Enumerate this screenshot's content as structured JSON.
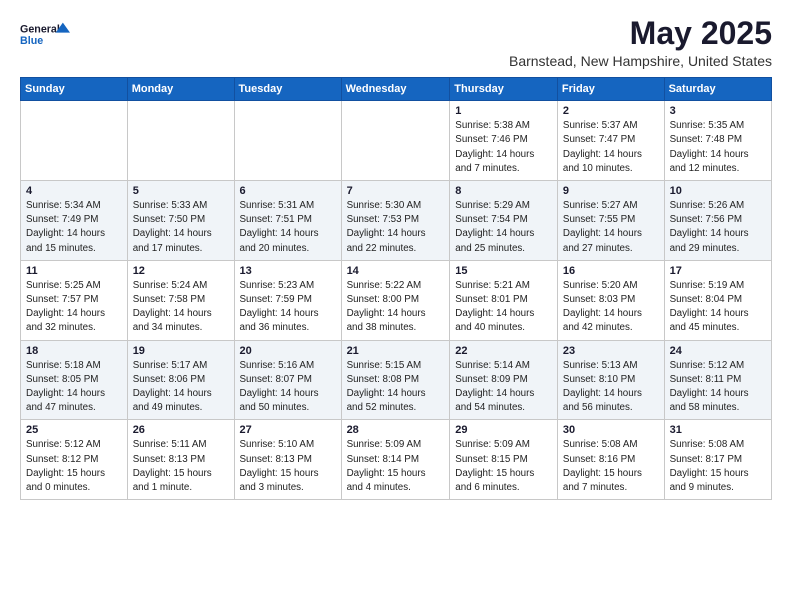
{
  "logo": {
    "text1": "General",
    "text2": "Blue"
  },
  "title": "May 2025",
  "subtitle": "Barnstead, New Hampshire, United States",
  "days_of_week": [
    "Sunday",
    "Monday",
    "Tuesday",
    "Wednesday",
    "Thursday",
    "Friday",
    "Saturday"
  ],
  "weeks": [
    [
      {
        "day": "",
        "detail": ""
      },
      {
        "day": "",
        "detail": ""
      },
      {
        "day": "",
        "detail": ""
      },
      {
        "day": "",
        "detail": ""
      },
      {
        "day": "1",
        "detail": "Sunrise: 5:38 AM\nSunset: 7:46 PM\nDaylight: 14 hours\nand 7 minutes."
      },
      {
        "day": "2",
        "detail": "Sunrise: 5:37 AM\nSunset: 7:47 PM\nDaylight: 14 hours\nand 10 minutes."
      },
      {
        "day": "3",
        "detail": "Sunrise: 5:35 AM\nSunset: 7:48 PM\nDaylight: 14 hours\nand 12 minutes."
      }
    ],
    [
      {
        "day": "4",
        "detail": "Sunrise: 5:34 AM\nSunset: 7:49 PM\nDaylight: 14 hours\nand 15 minutes."
      },
      {
        "day": "5",
        "detail": "Sunrise: 5:33 AM\nSunset: 7:50 PM\nDaylight: 14 hours\nand 17 minutes."
      },
      {
        "day": "6",
        "detail": "Sunrise: 5:31 AM\nSunset: 7:51 PM\nDaylight: 14 hours\nand 20 minutes."
      },
      {
        "day": "7",
        "detail": "Sunrise: 5:30 AM\nSunset: 7:53 PM\nDaylight: 14 hours\nand 22 minutes."
      },
      {
        "day": "8",
        "detail": "Sunrise: 5:29 AM\nSunset: 7:54 PM\nDaylight: 14 hours\nand 25 minutes."
      },
      {
        "day": "9",
        "detail": "Sunrise: 5:27 AM\nSunset: 7:55 PM\nDaylight: 14 hours\nand 27 minutes."
      },
      {
        "day": "10",
        "detail": "Sunrise: 5:26 AM\nSunset: 7:56 PM\nDaylight: 14 hours\nand 29 minutes."
      }
    ],
    [
      {
        "day": "11",
        "detail": "Sunrise: 5:25 AM\nSunset: 7:57 PM\nDaylight: 14 hours\nand 32 minutes."
      },
      {
        "day": "12",
        "detail": "Sunrise: 5:24 AM\nSunset: 7:58 PM\nDaylight: 14 hours\nand 34 minutes."
      },
      {
        "day": "13",
        "detail": "Sunrise: 5:23 AM\nSunset: 7:59 PM\nDaylight: 14 hours\nand 36 minutes."
      },
      {
        "day": "14",
        "detail": "Sunrise: 5:22 AM\nSunset: 8:00 PM\nDaylight: 14 hours\nand 38 minutes."
      },
      {
        "day": "15",
        "detail": "Sunrise: 5:21 AM\nSunset: 8:01 PM\nDaylight: 14 hours\nand 40 minutes."
      },
      {
        "day": "16",
        "detail": "Sunrise: 5:20 AM\nSunset: 8:03 PM\nDaylight: 14 hours\nand 42 minutes."
      },
      {
        "day": "17",
        "detail": "Sunrise: 5:19 AM\nSunset: 8:04 PM\nDaylight: 14 hours\nand 45 minutes."
      }
    ],
    [
      {
        "day": "18",
        "detail": "Sunrise: 5:18 AM\nSunset: 8:05 PM\nDaylight: 14 hours\nand 47 minutes."
      },
      {
        "day": "19",
        "detail": "Sunrise: 5:17 AM\nSunset: 8:06 PM\nDaylight: 14 hours\nand 49 minutes."
      },
      {
        "day": "20",
        "detail": "Sunrise: 5:16 AM\nSunset: 8:07 PM\nDaylight: 14 hours\nand 50 minutes."
      },
      {
        "day": "21",
        "detail": "Sunrise: 5:15 AM\nSunset: 8:08 PM\nDaylight: 14 hours\nand 52 minutes."
      },
      {
        "day": "22",
        "detail": "Sunrise: 5:14 AM\nSunset: 8:09 PM\nDaylight: 14 hours\nand 54 minutes."
      },
      {
        "day": "23",
        "detail": "Sunrise: 5:13 AM\nSunset: 8:10 PM\nDaylight: 14 hours\nand 56 minutes."
      },
      {
        "day": "24",
        "detail": "Sunrise: 5:12 AM\nSunset: 8:11 PM\nDaylight: 14 hours\nand 58 minutes."
      }
    ],
    [
      {
        "day": "25",
        "detail": "Sunrise: 5:12 AM\nSunset: 8:12 PM\nDaylight: 15 hours\nand 0 minutes."
      },
      {
        "day": "26",
        "detail": "Sunrise: 5:11 AM\nSunset: 8:13 PM\nDaylight: 15 hours\nand 1 minute."
      },
      {
        "day": "27",
        "detail": "Sunrise: 5:10 AM\nSunset: 8:13 PM\nDaylight: 15 hours\nand 3 minutes."
      },
      {
        "day": "28",
        "detail": "Sunrise: 5:09 AM\nSunset: 8:14 PM\nDaylight: 15 hours\nand 4 minutes."
      },
      {
        "day": "29",
        "detail": "Sunrise: 5:09 AM\nSunset: 8:15 PM\nDaylight: 15 hours\nand 6 minutes."
      },
      {
        "day": "30",
        "detail": "Sunrise: 5:08 AM\nSunset: 8:16 PM\nDaylight: 15 hours\nand 7 minutes."
      },
      {
        "day": "31",
        "detail": "Sunrise: 5:08 AM\nSunset: 8:17 PM\nDaylight: 15 hours\nand 9 minutes."
      }
    ]
  ]
}
